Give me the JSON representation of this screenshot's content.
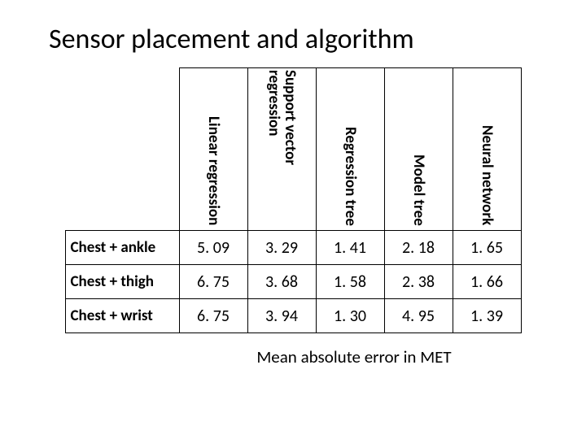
{
  "title": "Sensor placement and algorithm",
  "caption": "Mean absolute error in MET",
  "columns": {
    "c1": "Linear regression",
    "c2": "Support vector regression",
    "c3": "Regression tree",
    "c4": "Model tree",
    "c5": "Neural network"
  },
  "rows": {
    "r1": {
      "label": "Chest + ankle",
      "c1": "5. 09",
      "c2": "3. 29",
      "c3": "1. 41",
      "c4": "2. 18",
      "c5": "1. 65"
    },
    "r2": {
      "label": "Chest + thigh",
      "c1": "6. 75",
      "c2": "3. 68",
      "c3": "1. 58",
      "c4": "2. 38",
      "c5": "1. 66"
    },
    "r3": {
      "label": "Chest + wrist",
      "c1": "6. 75",
      "c2": "3. 94",
      "c3": "1. 30",
      "c4": "4. 95",
      "c5": "1. 39"
    }
  },
  "chart_data": {
    "type": "table",
    "title": "Sensor placement and algorithm",
    "ylabel": "Mean absolute error in MET",
    "categories": [
      "Linear regression",
      "Support vector regression",
      "Regression tree",
      "Model tree",
      "Neural network"
    ],
    "series": [
      {
        "name": "Chest + ankle",
        "values": [
          5.09,
          3.29,
          1.41,
          2.18,
          1.65
        ]
      },
      {
        "name": "Chest + thigh",
        "values": [
          6.75,
          3.68,
          1.58,
          2.38,
          1.66
        ]
      },
      {
        "name": "Chest + wrist",
        "values": [
          6.75,
          3.94,
          1.3,
          4.95,
          1.39
        ]
      }
    ]
  }
}
